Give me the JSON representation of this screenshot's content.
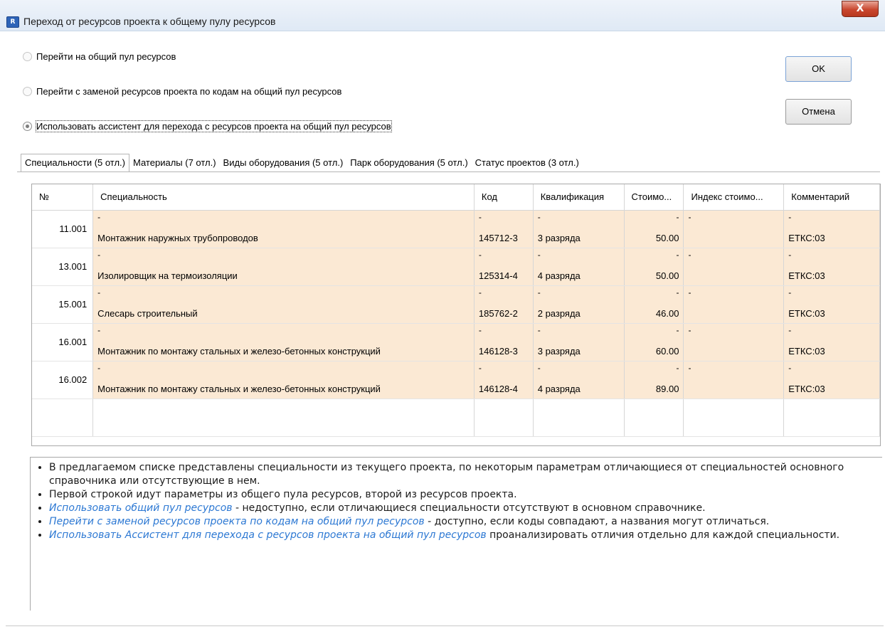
{
  "window": {
    "title": "Переход от ресурсов проекта к общему пулу ресурсов",
    "close_glyph": "X",
    "app_icon_text": "R"
  },
  "options": [
    {
      "label": "Перейти на общий пул ресурсов",
      "checked": false
    },
    {
      "label": "Перейти с заменой ресурсов проекта по кодам на общий пул ресурсов",
      "checked": false
    },
    {
      "label": "Использовать ассистент для перехода с ресурсов проекта на общий пул ресурсов",
      "checked": true
    }
  ],
  "buttons": {
    "ok": "OK",
    "cancel": "Отмена"
  },
  "tabs": [
    {
      "label": "Специальности (5 отл.)",
      "active": true
    },
    {
      "label": "Материалы (7 отл.)",
      "active": false
    },
    {
      "label": "Виды оборудования (5 отл.)",
      "active": false
    },
    {
      "label": "Парк оборудования (5 отл.)",
      "active": false
    },
    {
      "label": "Статус проектов (3 отл.)",
      "active": false
    }
  ],
  "table": {
    "columns": [
      "№",
      "Специальность",
      "Код",
      "Квалификация",
      "Стоимо...",
      "Индекс стоимо...",
      "Комментарий"
    ],
    "rows": [
      {
        "num": "11.001",
        "name": [
          "-",
          "Монтажник наружных трубопроводов"
        ],
        "code": [
          "-",
          "145712-3"
        ],
        "qual": [
          "-",
          "3 разряда"
        ],
        "cost": [
          "-",
          "50.00"
        ],
        "index": [
          "-",
          ""
        ],
        "comment": [
          "-",
          "ЕТКС:03"
        ]
      },
      {
        "num": "13.001",
        "name": [
          "-",
          "Изолировщик на термоизоляции"
        ],
        "code": [
          "-",
          "125314-4"
        ],
        "qual": [
          "-",
          "4 разряда"
        ],
        "cost": [
          "-",
          "50.00"
        ],
        "index": [
          "-",
          ""
        ],
        "comment": [
          "-",
          "ЕТКС:03"
        ]
      },
      {
        "num": "15.001",
        "name": [
          "-",
          "Слесарь строительный"
        ],
        "code": [
          "-",
          "185762-2"
        ],
        "qual": [
          "-",
          "2 разряда"
        ],
        "cost": [
          "-",
          "46.00"
        ],
        "index": [
          "-",
          ""
        ],
        "comment": [
          "-",
          "ЕТКС:03"
        ]
      },
      {
        "num": "16.001",
        "name": [
          "-",
          "Монтажник по монтажу стальных и железо-бетонных конструкций"
        ],
        "code": [
          "-",
          "146128-3"
        ],
        "qual": [
          "-",
          "3 разряда"
        ],
        "cost": [
          "-",
          "60.00"
        ],
        "index": [
          "-",
          ""
        ],
        "comment": [
          "-",
          "ЕТКС:03"
        ]
      },
      {
        "num": "16.002",
        "name": [
          "-",
          "Монтажник по монтажу стальных и железо-бетонных конструкций"
        ],
        "code": [
          "-",
          "146128-4"
        ],
        "qual": [
          "-",
          "4 разряда"
        ],
        "cost": [
          "-",
          "89.00"
        ],
        "index": [
          "-",
          ""
        ],
        "comment": [
          "-",
          "ЕТКС:03"
        ]
      }
    ]
  },
  "info": {
    "item1": "В предлагаемом списке представлены специальности из текущего проекта, по некоторым параметрам отличающиеся от специальностей основного справочника или отсутствующие в нем.",
    "item2": "Первой строкой идут параметры из общего пула ресурсов, второй из ресурсов проекта.",
    "item3_link": "Использовать общий пул ресурсов",
    "item3_text": " - недоступно, если отличающиеся специальности отсутствуют в основном справочнике.",
    "item4_link": "Перейти с заменой ресурсов проекта по кодам на общий пул ресурсов",
    "item4_text": " - доступно, если коды совпадают, а названия могут отличаться.",
    "item5_link": "Использовать Ассистент для перехода с ресурсов проекта на общий пул ресурсов",
    "item5_text": " проанализировать отличия отдельно для каждой специальности."
  },
  "colors": {
    "row_highlight": "#fbe9d4",
    "link": "#2c78d3",
    "close_button": "#c9472f"
  },
  "icons": [
    "app-icon",
    "close-icon"
  ]
}
